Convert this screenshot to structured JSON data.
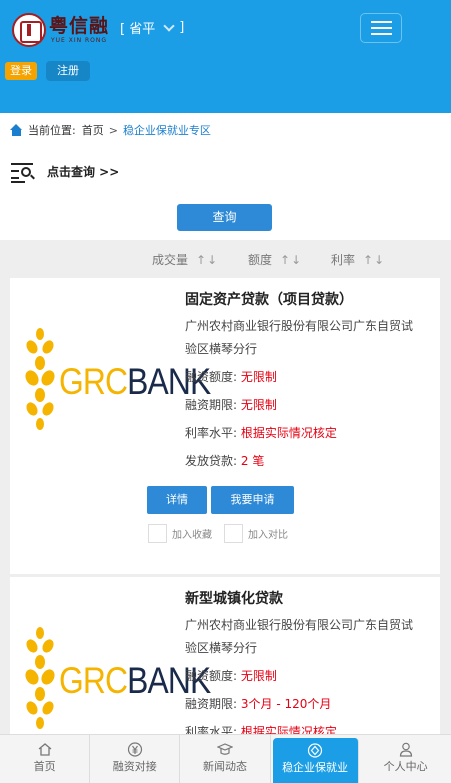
{
  "header": {
    "logo_cn": "粤信融",
    "logo_en": "YUE XIN RONG",
    "region": "[ 省平",
    "region_close": "]",
    "login": "登录",
    "register": "注册"
  },
  "breadcrumb": {
    "prefix": "当前位置:",
    "home": "首页",
    "separator": ">",
    "current": "稳企业保就业专区"
  },
  "query": {
    "label": "点击查询 >>",
    "search_button": "查询"
  },
  "sort": {
    "items": [
      {
        "label": "成交量",
        "arrows": "↑↓"
      },
      {
        "label": "额度",
        "arrows": "↑↓"
      },
      {
        "label": "利率",
        "arrows": "↑↓"
      }
    ]
  },
  "bank_logo": {
    "grc": "GRC",
    "bank": "BANK",
    "brand_color": "#f5b400"
  },
  "products": [
    {
      "title": "固定资产贷款（项目贷款）",
      "org": "广州农村商业银行股份有限公司广东自贸试验区横琴分行",
      "amount_label": "融资额度:",
      "amount": "无限制",
      "term_label": "融资期限:",
      "term": "无限制",
      "rate_label": "利率水平:",
      "rate": "根据实际情况核定",
      "loans_label": "发放贷款:",
      "loans": "2 笔",
      "detail": "详情",
      "apply": "我要申请",
      "favorite": "加入收藏",
      "compare": "加入对比"
    },
    {
      "title": "新型城镇化贷款",
      "org": "广州农村商业银行股份有限公司广东自贸试验区横琴分行",
      "amount_label": "融资额度:",
      "amount": "无限制",
      "term_label": "融资期限:",
      "term": "3个月 - 120个月",
      "rate_label": "利率水平:",
      "rate": "根据实际情况核定"
    }
  ],
  "bottom_nav": [
    {
      "label": "首页",
      "icon": "home-icon"
    },
    {
      "label": "融资对接",
      "icon": "yuan-icon"
    },
    {
      "label": "新闻动态",
      "icon": "graduation-cap-icon"
    },
    {
      "label": "稳企业保就业",
      "icon": "shield-icon"
    },
    {
      "label": "个人中心",
      "icon": "user-icon"
    }
  ],
  "colors": {
    "primary": "#1b9ee5",
    "button": "#2e8ad6",
    "highlight": "#e60012",
    "login": "#f5a300"
  }
}
